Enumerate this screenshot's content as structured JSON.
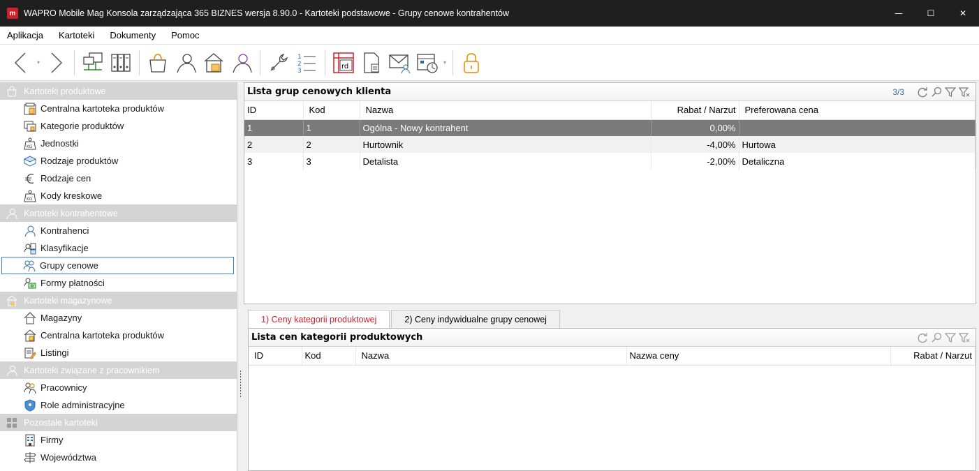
{
  "window": {
    "app_icon_letter": "m",
    "title": "WAPRO Mobile Mag Konsola zarządzająca 365 BIZNES wersja 8.90.0 - Kartoteki podstawowe - Grupy cenowe kontrahentów",
    "minimize": "—",
    "maximize": "☐",
    "close": "✕"
  },
  "menu": [
    "Aplikacja",
    "Kartoteki",
    "Dokumenty",
    "Pomoc"
  ],
  "toolbar": {
    "calendar_label": "rd"
  },
  "sidebar": {
    "sections": [
      {
        "title": "Kartoteki produktowe",
        "icon": "shopping-bag-icon",
        "items": [
          {
            "label": "Centralna kartoteka produktów",
            "icon": "warehouse-icon"
          },
          {
            "label": "Kategorie produktów",
            "icon": "categories-icon"
          },
          {
            "label": "Jednostki",
            "icon": "weight-icon"
          },
          {
            "label": "Rodzaje produktów",
            "icon": "box-icon"
          },
          {
            "label": "Rodzaje cen",
            "icon": "euro-icon"
          },
          {
            "label": "Kody kreskowe",
            "icon": "weight-icon"
          }
        ]
      },
      {
        "title": "Kartoteki kontrahentowe",
        "icon": "person-icon",
        "items": [
          {
            "label": "Kontrahenci",
            "icon": "person-icon"
          },
          {
            "label": "Klasyfikacje",
            "icon": "classification-icon"
          },
          {
            "label": "Grupy cenowe",
            "icon": "group-icon",
            "selected": true
          },
          {
            "label": "Formy płatności",
            "icon": "payment-icon"
          }
        ]
      },
      {
        "title": "Kartoteki magazynowe",
        "icon": "warehouse-icon",
        "items": [
          {
            "label": "Magazyny",
            "icon": "house-icon"
          },
          {
            "label": "Centralna kartoteka produktów",
            "icon": "warehouse-icon"
          },
          {
            "label": "Listingi",
            "icon": "listing-icon"
          }
        ]
      },
      {
        "title": "Kartoteki związane z pracownikiem",
        "icon": "person-icon",
        "items": [
          {
            "label": "Pracownicy",
            "icon": "group-icon"
          },
          {
            "label": "Role administracyjne",
            "icon": "shield-icon"
          }
        ]
      },
      {
        "title": "Pozostałe kartoteki",
        "icon": "grid-icon",
        "items": [
          {
            "label": "Firmy",
            "icon": "building-icon"
          },
          {
            "label": "Województwa",
            "icon": "signpost-icon"
          }
        ]
      }
    ]
  },
  "upper_panel": {
    "title": "Lista grup cenowych klienta",
    "count": "3/3",
    "columns": [
      "ID",
      "Kod",
      "Nazwa",
      "Rabat / Narzut",
      "Preferowana cena"
    ],
    "rows": [
      {
        "id": "1",
        "kod": "1",
        "nazwa": "Ogólna - Nowy kontrahent",
        "rabat": "0,00%",
        "cena": ""
      },
      {
        "id": "2",
        "kod": "2",
        "nazwa": "Hurtownik",
        "rabat": "-4,00%",
        "cena": "Hurtowa"
      },
      {
        "id": "3",
        "kod": "3",
        "nazwa": "Detalista",
        "rabat": "-2,00%",
        "cena": "Detaliczna"
      }
    ]
  },
  "tabs": [
    "1) Ceny kategorii produktowej",
    "2) Ceny indywidualne grupy cenowej"
  ],
  "lower_panel": {
    "title": "Lista cen kategorii produktowych",
    "columns": [
      "ID",
      "Kod",
      "Nazwa",
      "Nazwa ceny",
      "Rabat / Narzut"
    ]
  },
  "colors": {
    "accent_red": "#d0202a",
    "selection_gray": "#7a7a7a",
    "section_header": "#d4d4d4",
    "link_blue": "#3b6ea5"
  }
}
